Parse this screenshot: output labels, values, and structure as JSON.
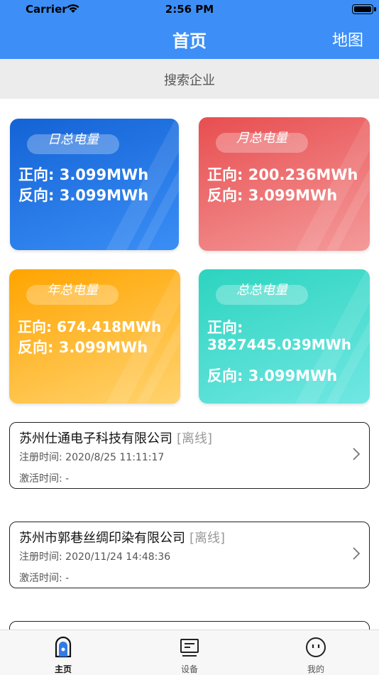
{
  "status_bar": {
    "carrier": "Carrier",
    "time": "2:56 PM"
  },
  "nav": {
    "title": "首页",
    "right_label": "地图"
  },
  "search": {
    "placeholder": "搜索企业"
  },
  "cards": [
    {
      "title": "日总电量",
      "forward": "正向: 3.099MWh",
      "reverse": "反向: 3.099MWh"
    },
    {
      "title": "月总电量",
      "forward": "正向: 200.236MWh",
      "reverse": "反向: 3.099MWh"
    },
    {
      "title": "年总电量",
      "forward": "正向: 674.418MWh",
      "reverse": "反向: 3.099MWh"
    },
    {
      "title": "总总电量",
      "forward_label": "正向:",
      "forward_value": "3827445.039MWh",
      "reverse": "反向: 3.099MWh"
    }
  ],
  "companies": [
    {
      "name": "苏州仕通电子科技有限公司",
      "status": "[离线]",
      "reg_time": "注册时间: 2020/8/25 11:11:17",
      "activate_time": "激活时间: -"
    },
    {
      "name": "苏州市郭巷丝绸印染有限公司",
      "status": "[离线]",
      "reg_time": "注册时间: 2020/11/24 14:48:36",
      "activate_time": "激活时间: -"
    }
  ],
  "tabbar": {
    "items": [
      {
        "label": "主页",
        "icon": "home-icon",
        "active": true
      },
      {
        "label": "设备",
        "icon": "device-icon",
        "active": false
      },
      {
        "label": "我的",
        "icon": "profile-icon",
        "active": false
      }
    ]
  },
  "colors": {
    "nav_blue": "#3d8ff7",
    "card_blue": "#1463d6",
    "card_red": "#e84e50",
    "card_orange": "#ffa400",
    "card_teal": "#2cd4bf"
  }
}
